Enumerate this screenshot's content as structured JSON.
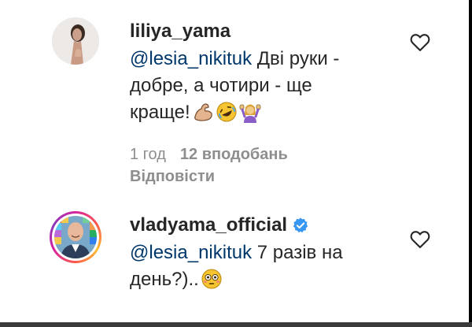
{
  "comments": [
    {
      "username": "liliya_yama",
      "mention": "@lesia_nikituk",
      "text_line1_rest": " Дві руки -",
      "text_line2": "добре, а чотири - ще",
      "text_line3": "краще!",
      "emojis": [
        "flexed-biceps-emoji",
        "rolling-on-floor-laughing-emoji",
        "woman-raising-hands-emoji"
      ],
      "time": "1 год",
      "likes": "12 вподобань",
      "reply_label": "Відповісти",
      "verified": false
    },
    {
      "username": "vladyama_official",
      "mention": "@lesia_nikituk",
      "text_line1_rest": " 7 разів на",
      "text_line2": "день?)..",
      "emojis": [
        "flushed-face-emoji"
      ],
      "verified": true
    }
  ],
  "colors": {
    "text": "#262626",
    "mention": "#00376b",
    "meta": "#8e8e8e",
    "verified": "#3897f0"
  }
}
